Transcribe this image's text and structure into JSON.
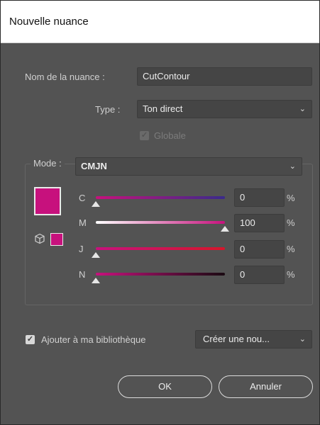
{
  "dialog": {
    "title": "Nouvelle nuance"
  },
  "swatch_name": {
    "label": "Nom de la nuance :",
    "value": "CutContour"
  },
  "type": {
    "label": "Type :",
    "selected": "Ton direct"
  },
  "global": {
    "label": "Globale",
    "checked": true,
    "enabled": false
  },
  "mode": {
    "label": "Mode :",
    "selected": "CMJN"
  },
  "color": {
    "swatch_color": "#c7117d"
  },
  "channels": [
    {
      "letter": "C",
      "value": "0",
      "unit": "%",
      "level": 0
    },
    {
      "letter": "M",
      "value": "100",
      "unit": "%",
      "level": 100
    },
    {
      "letter": "J",
      "value": "0",
      "unit": "%",
      "level": 0
    },
    {
      "letter": "N",
      "value": "0",
      "unit": "%",
      "level": 0
    }
  ],
  "library": {
    "label": "Ajouter à ma bibliothèque",
    "checked": true,
    "selected": "Créer une nou..."
  },
  "buttons": {
    "ok": "OK",
    "cancel": "Annuler"
  },
  "icons": {
    "dropdown": "chevron-down-icon",
    "out_of_gamut": "cube-icon",
    "checkbox": "checkmark-icon"
  }
}
